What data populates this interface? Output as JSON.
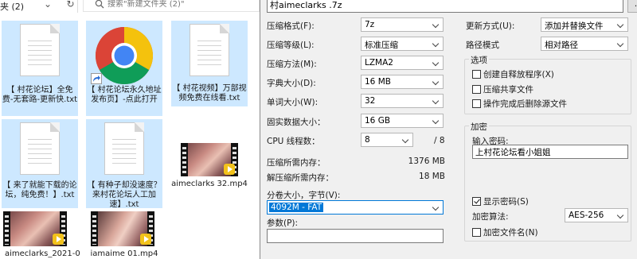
{
  "explorer": {
    "path_fragment": "夹 (2)",
    "refresh_glyph": "↻",
    "search_placeholder": "搜索\"新建文件夹 (2)\"",
    "files": [
      {
        "name": "【 村花论坛】全免费-无套路-更新快.txt",
        "type": "text",
        "selected": true
      },
      {
        "name": "【 村花论坛永久地址发布页】-点此打开",
        "type": "shortcut",
        "selected": true
      },
      {
        "name": "【 村花视频】万部视频免费在线看.txt",
        "type": "text",
        "selected": true
      },
      {
        "name": "【 来了就能下载的论坛，纯免费！】.txt",
        "type": "text",
        "selected": true
      },
      {
        "name": "【 有种子却没速度？来村花论坛人工加速】.txt",
        "type": "text",
        "selected": true
      },
      {
        "name": "aimeclarks 32.mp4",
        "type": "video",
        "selected": false
      },
      {
        "name": "aimeclarks_2021-0",
        "type": "video",
        "selected": false
      },
      {
        "name": "iamaime 01.mp4",
        "type": "video",
        "selected": false
      }
    ]
  },
  "dialog": {
    "archive_name": "村aimeclarks .7z",
    "browse_label": "...",
    "format": {
      "label": "压缩格式(F):",
      "value": "7z"
    },
    "level": {
      "label": "压缩等级(L):",
      "value": "标准压缩"
    },
    "method": {
      "label": "压缩方法(M):",
      "value": "LZMA2"
    },
    "dict": {
      "label": "字典大小(D):",
      "value": "16 MB"
    },
    "word": {
      "label": "单词大小(W):",
      "value": "32"
    },
    "solid": {
      "label": "固实数据大小：",
      "value": "16 GB"
    },
    "threads": {
      "label": "CPU 线程数：",
      "value": "8",
      "max": "/ 8"
    },
    "mem_compress": {
      "label": "压缩所需内存：",
      "value": "1376 MB"
    },
    "mem_decompress": {
      "label": "解压缩所需内存：",
      "value": "18 MB"
    },
    "volume": {
      "label": "分卷大小，字节(V):",
      "value": "4092M - FAT"
    },
    "params": {
      "label": "参数(P):",
      "value": ""
    },
    "update_mode": {
      "label": "更新方式(U):",
      "value": "添加并替换文件"
    },
    "path_mode": {
      "label": "路径模式",
      "value": "相对路径"
    },
    "options": {
      "title": "选项",
      "items": [
        {
          "label": "创建自释放程序(X)",
          "checked": false
        },
        {
          "label": "压缩共享文件",
          "checked": false
        },
        {
          "label": "操作完成后删除源文件",
          "checked": false
        }
      ]
    },
    "encryption": {
      "title": "加密",
      "password_label": "输入密码:",
      "password_value": "上村花论坛看小姐姐",
      "show_password": {
        "label": "显示密码(S)",
        "checked": true
      },
      "method_label": "加密算法:",
      "method_value": "AES-256",
      "encrypt_names": {
        "label": "加密文件名(N)",
        "checked": false
      }
    }
  }
}
